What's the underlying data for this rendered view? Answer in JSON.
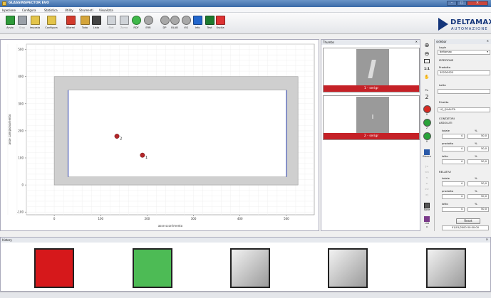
{
  "window": {
    "title": "GLASSINSPECTOR EVO",
    "min": "–",
    "max": "□",
    "close": "×"
  },
  "menu": [
    "Ispezione",
    "Configura",
    "Statistica",
    "Utility",
    "Strumenti",
    "Visualizza"
  ],
  "toolbar": [
    {
      "label": "Avvio",
      "icon": "play-arrow-icon",
      "color": "#2e9b3a",
      "enabled": true
    },
    {
      "label": "Stop",
      "icon": "stop-icon",
      "color": "#9aa0a8",
      "enabled": false
    },
    {
      "label": "Imposta",
      "icon": "settings-doc-icon",
      "color": "#e3c44a",
      "enabled": true
    },
    {
      "label": "Configura",
      "icon": "configure-icon",
      "color": "#e3c44a",
      "enabled": true
    },
    {
      "label": "Allarmi",
      "icon": "alarm-icon",
      "color": "#d23a2c",
      "enabled": true
    },
    {
      "label": "Todo",
      "icon": "grid-icon",
      "color": "#d4a43a",
      "enabled": true
    },
    {
      "label": "Lista",
      "icon": "traffic-light-icon",
      "color": "#444",
      "enabled": true
    },
    {
      "label": "Stat",
      "icon": "stat-icon",
      "color": "#cfd3d8",
      "enabled": false
    },
    {
      "label": "Zoma",
      "icon": "zoom-doc-icon",
      "color": "#cfd3d8",
      "enabled": false
    },
    {
      "label": "RDY",
      "icon": "ready-light-icon",
      "color": "#3fb84a",
      "enabled": true
    },
    {
      "label": "ERR",
      "icon": "error-light-icon",
      "color": "#a8a8a8",
      "enabled": true
    },
    {
      "label": "DP",
      "icon": "dp-light-icon",
      "color": "#a8a8a8",
      "enabled": true
    },
    {
      "label": "BLAB",
      "icon": "blab-light-icon",
      "color": "#a8a8a8",
      "enabled": true
    },
    {
      "label": "VIS",
      "icon": "vis-light-icon",
      "color": "#a8a8a8",
      "enabled": true
    },
    {
      "label": "Info",
      "icon": "info-icon",
      "color": "#2266cc",
      "enabled": true
    },
    {
      "label": "Test",
      "icon": "test-icon",
      "color": "#1d7a2e",
      "enabled": true
    },
    {
      "label": "Uscita",
      "icon": "exit-icon",
      "color": "#d33",
      "enabled": true
    }
  ],
  "logo": {
    "name": "DELTAMAX",
    "sub": "AUTOMAZIONE"
  },
  "chart_data": {
    "type": "scatter",
    "title": "",
    "xlabel": "asse scorrimento",
    "ylabel": "asse campionamento",
    "xlim": [
      -60,
      560
    ],
    "ylim": [
      -110,
      520
    ],
    "xticks": [
      0,
      100,
      200,
      300,
      400,
      500
    ],
    "yticks": [
      -100,
      0,
      100,
      200,
      300,
      400,
      500
    ],
    "grid": true,
    "glass": {
      "outer": [
        0,
        0,
        525,
        400
      ],
      "inner": [
        30,
        30,
        500,
        350
      ]
    },
    "points": [
      {
        "label": "1",
        "x": 190,
        "y": 110
      },
      {
        "label": "2",
        "x": 135,
        "y": 180
      }
    ]
  },
  "thumbs": {
    "title": "Thumbs",
    "items": [
      {
        "label": "1 - serigr"
      },
      {
        "label": "2 - serigr"
      }
    ]
  },
  "vtools": {
    "items": [
      "zoom-in-icon",
      "zoom-out-icon",
      "fit-icon",
      "1:1",
      "pan-icon"
    ],
    "pz_label": "Pz.",
    "pz_value": "2",
    "lights": [
      {
        "n": "0",
        "color": "#d62a22"
      },
      {
        "n": "2",
        "color": "#2aa33a"
      },
      {
        "n": "0",
        "color": "#2aa33a"
      }
    ],
    "blocca": "Blocca",
    "nav": [
      "|<",
      "<<",
      "<",
      ">",
      ">>",
      ">|"
    ],
    "save": "Save",
    "list": "List",
    "close": "x"
  },
  "sidebar": {
    "title": "sidebar",
    "login_label": "Login",
    "login_value": "deltamax",
    "ispezione": "ISPEZIONE",
    "prodotto_label": "Prodotto",
    "prodotto_value": "3S2DOS2S",
    "lotto_label": "Lotto",
    "lotto_value": "",
    "ricetta_label": "Ricetta",
    "ricetta_value": "LQ_QUALITA",
    "contatori": "CONTATORI",
    "assoluti": "ASSOLUTI",
    "relativi": "RELATIVI",
    "pct": "%",
    "abs": [
      {
        "label": "totale",
        "value": "4",
        "pct": "50,0"
      },
      {
        "label": "prodotto",
        "value": "4",
        "pct": "50,0"
      },
      {
        "label": "lotto",
        "value": "4",
        "pct": "50,0"
      }
    ],
    "rel": [
      {
        "label": "totale",
        "value": "4",
        "pct": "50,0"
      },
      {
        "label": "prodotto",
        "value": "4",
        "pct": "50,0"
      },
      {
        "label": "lotto",
        "value": "4",
        "pct": "50,0"
      }
    ],
    "reset": "Reset",
    "datetime": "01/01/2000 00:00:00"
  },
  "history": {
    "title": "history",
    "boxes": [
      {
        "color": "#d6181b",
        "state": "red"
      },
      {
        "color": "#4dbb55",
        "state": "green"
      },
      {
        "color": "#b8b8b8",
        "state": "gray"
      },
      {
        "color": "#b8b8b8",
        "state": "gray"
      },
      {
        "color": "#b8b8b8",
        "state": "gray"
      }
    ]
  }
}
